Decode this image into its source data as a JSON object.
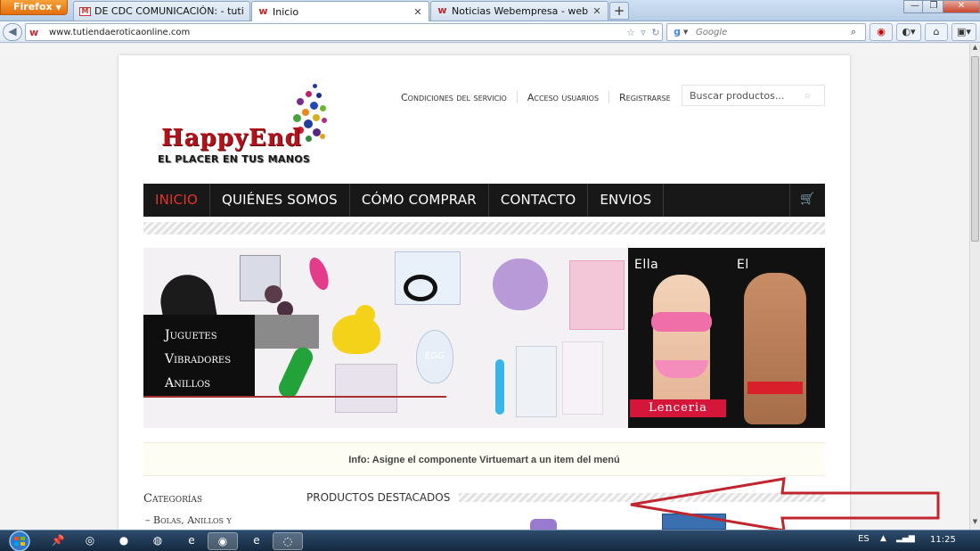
{
  "browser": {
    "app_button": "Firefox",
    "tabs": [
      {
        "label": "DE CDC COMUNICACIÓN: - tutiendaero...",
        "favicon": "gmail-icon"
      },
      {
        "label": "Inicio",
        "favicon": "site-w-icon"
      },
      {
        "label": "Noticias Webempresa - webempresa joo...",
        "favicon": "site-w-icon"
      }
    ],
    "new_tab": "+",
    "url": "www.tutiendaeroticaonline.com",
    "search_placeholder": "Google"
  },
  "site": {
    "brand": "HappyEnd",
    "tagline": "EL PLACER EN TUS MANOS",
    "top_links": [
      "Condiciones del servicio",
      "Acceso usuarios",
      "Registrarse"
    ],
    "search_placeholder": "Buscar productos...",
    "menu": [
      {
        "label": "INICIO",
        "active": true
      },
      {
        "label": "QUIÉNES SOMOS",
        "active": false
      },
      {
        "label": "CÓMO COMPRAR",
        "active": false
      },
      {
        "label": "CONTACTO",
        "active": false
      },
      {
        "label": "ENVIOS",
        "active": false
      }
    ],
    "banner": {
      "categories": [
        "Juguetes",
        "Vibradores",
        "Anillos"
      ],
      "ella_label": "Ella",
      "el_label": "El",
      "lenceria_label": "Lenceria",
      "egg_label": "EGG"
    },
    "info_message": "Info: Asigne el componente Virtuemart a un item del menú",
    "sidebar": {
      "title": "Categorías",
      "items": [
        "– Bolas, Anillos y"
      ]
    },
    "featured_title": "PRODUCTOS DESTACADOS"
  },
  "taskbar": {
    "language": "ES",
    "clock": "11:25"
  },
  "colors": {
    "accent_red": "#e5332a",
    "menu_bg": "#181818",
    "lenceria": "#d4163b",
    "annotation_arrow": "#c0262d"
  }
}
